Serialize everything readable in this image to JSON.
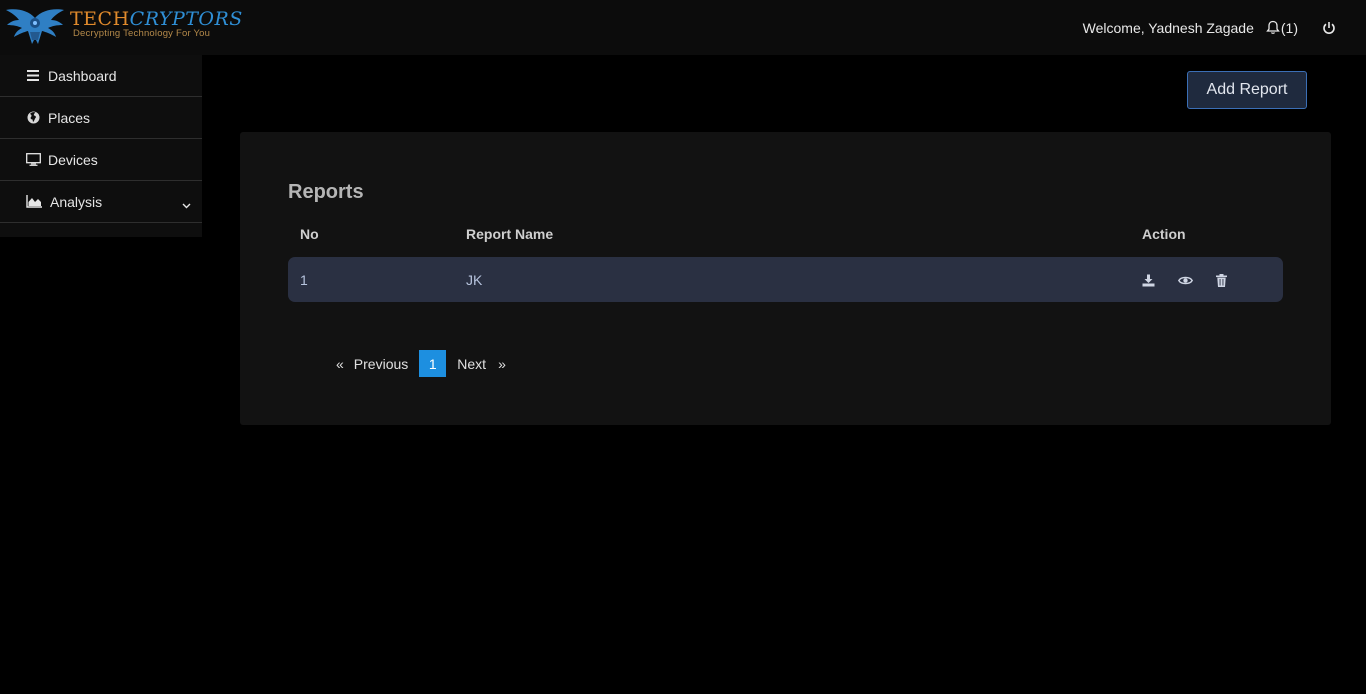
{
  "brand": {
    "name_part1": "TECH",
    "name_part2": "CRYPTORS",
    "tagline": "Decrypting Technology For You"
  },
  "header": {
    "welcome": "Welcome, Yadnesh Zagade",
    "notification_count": "(1)"
  },
  "sidebar": {
    "items": [
      {
        "label": "Dashboard",
        "icon": "bars-icon"
      },
      {
        "label": "Places",
        "icon": "globe-icon"
      },
      {
        "label": "Devices",
        "icon": "monitor-icon"
      },
      {
        "label": "Analysis",
        "icon": "area-chart-icon"
      }
    ]
  },
  "main": {
    "add_button": "Add Report",
    "title": "Reports",
    "columns": [
      "No",
      "Report Name",
      "Action"
    ],
    "rows": [
      {
        "no": "1",
        "name": "JK"
      }
    ],
    "pagination": {
      "prev_arrow": "«",
      "prev": "Previous",
      "current": "1",
      "next": "Next",
      "next_arrow": "»"
    }
  },
  "colors": {
    "accent": "#1d8fe0",
    "row_bg": "#2a3042",
    "card_bg": "#121212",
    "brand_orange": "#e08a2c",
    "brand_blue": "#2f8fd6"
  }
}
